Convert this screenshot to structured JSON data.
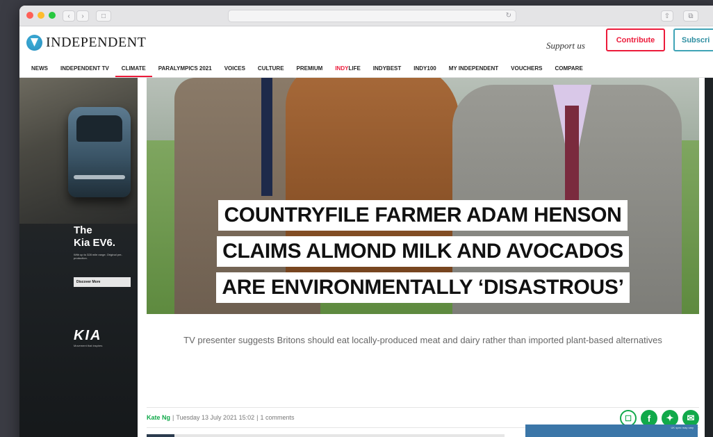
{
  "browser": {
    "address_text": "",
    "traffic_colors": [
      "#fe5f57",
      "#febc2e",
      "#28c840"
    ]
  },
  "header": {
    "logo_text": "INDEPENDENT",
    "support_text": "Support us",
    "contribute_label": "Contribute",
    "subscribe_label": "Subscri"
  },
  "nav": {
    "items": [
      {
        "label": "NEWS"
      },
      {
        "label": "INDEPENDENT TV"
      },
      {
        "label": "CLIMATE"
      },
      {
        "label": "PARALYMPICS 2021"
      },
      {
        "label": "VOICES"
      },
      {
        "label": "CULTURE"
      },
      {
        "label": "PREMIUM"
      },
      {
        "label_a": "INDY",
        "label_b": "LIFE"
      },
      {
        "label": "INDYBEST"
      },
      {
        "label": "INDY100"
      },
      {
        "label": "MY INDEPENDENT"
      },
      {
        "label": "VOUCHERS"
      },
      {
        "label": "COMPARE"
      }
    ],
    "active": "CLIMATE"
  },
  "ad": {
    "title_line1": "The",
    "title_line2": "Kia EV6.",
    "fine_print": "With up to 328 mile range. Original pre-production.",
    "button_label": "Discover More",
    "logo": "KIA",
    "tagline": "Movement that inspires"
  },
  "article": {
    "headline_lines": [
      "COUNTRYFILE FARMER ADAM HENSON",
      "CLAIMS ALMOND MILK AND AVOCADOS",
      "ARE ENVIRONMENTALLY ‘DISASTROUS’"
    ],
    "standfirst": "TV presenter suggests Britons should eat locally-produced meat and dairy rather than imported plant-based alternatives",
    "author": "Kate Ng",
    "date": "Tuesday 13 July 2021 15:02",
    "comments": "1 comments",
    "accent_color": "#11a94a"
  },
  "mini_ad": {
    "fine": "UK spec may vary"
  }
}
